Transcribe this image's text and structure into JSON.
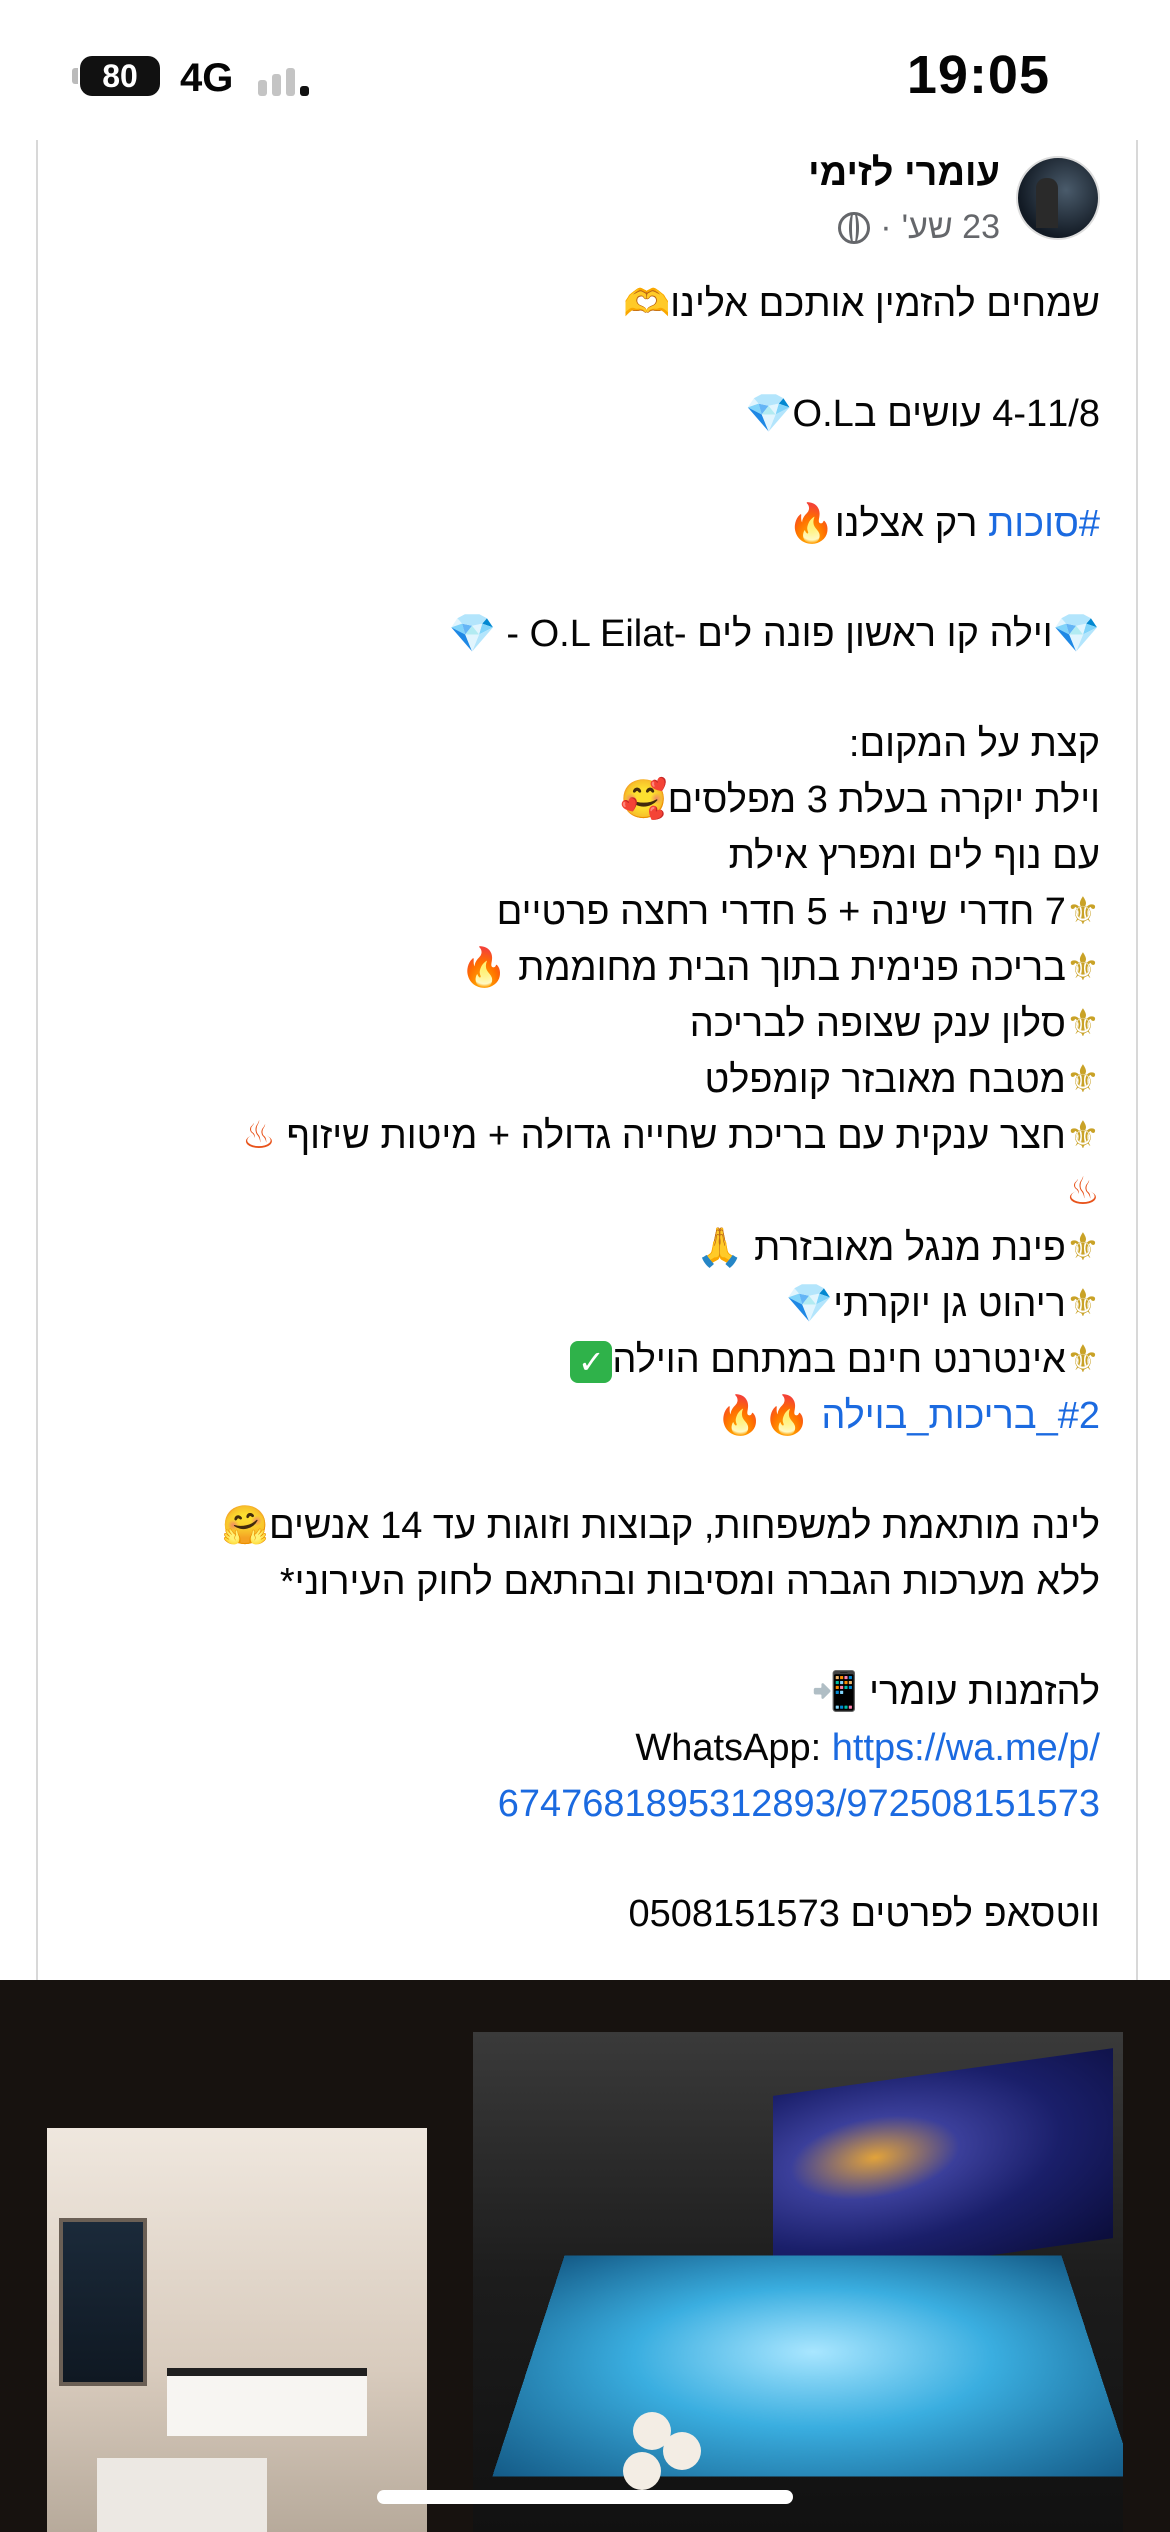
{
  "status_bar": {
    "time": "19:05",
    "battery": "80",
    "network": "4G"
  },
  "post": {
    "author": "עומרי לזימי",
    "time": "23 שע'",
    "dot": "·",
    "lines": [
      {
        "text": "שמחים להזמין אותכם אלינו",
        "emoji": "🫶"
      },
      {
        "text": "4-11/8 עושים בO.L",
        "emoji": "💎"
      },
      {
        "hashtag": "#סוכות",
        "text": " רק אצלנו",
        "emoji": "🔥"
      },
      {
        "emoji_pre": "💎",
        "text": "וילה קו ראשון פונה לים -O.L Eilat - ",
        "emoji": "💎"
      },
      {
        "text": "קצת על המקום:"
      },
      {
        "text": "וילת יוקרה בעלת 3 מפלסים",
        "emoji": "🥰"
      },
      {
        "text": "עם נוף לים ומפרץ אילת"
      },
      {
        "bullet": "⚜",
        "text": "7 חדרי שינה + 5 חדרי רחצה פרטיים"
      },
      {
        "bullet": "⚜",
        "text": "בריכה פנימית בתוך הבית מחוממת ",
        "emoji": "🔥"
      },
      {
        "bullet": "⚜",
        "text": "סלון ענק שצופה לבריכה"
      },
      {
        "bullet": "⚜",
        "text": "מטבח מאובזר קומפלט"
      },
      {
        "bullet": "⚜",
        "text": "חצר ענקית עם בריכת שחייה גדולה + מיטות שיזוף ",
        "emoji": "♨"
      },
      {
        "text": "",
        "emoji": "♨"
      },
      {
        "bullet": "⚜",
        "text": "פינת מנגל מאובזרת ",
        "emoji": "🙏"
      },
      {
        "bullet": "⚜",
        "text": "ריהוט גן יוקרתי",
        "emoji": "💎"
      },
      {
        "bullet": "⚜",
        "text": "אינטרנט חינם במתחם הוילה",
        "emoji": "✓"
      },
      {
        "hashtag": "#2_בריכות_בוילה",
        "text": " ",
        "emoji": "🔥🔥"
      },
      {
        "text": "לינה מותאמת למשפחות, קבוצות וזוגות עד 14 אנשים",
        "emoji": "🤗"
      },
      {
        "text": "ללא מערכות הגברה ומסיבות ובהתאם לחוק העירוני*"
      },
      {
        "text": "להזמנות עומרי ",
        "emoji": "📲"
      },
      {
        "prefix": "WhatsApp: ",
        "url1": "https://wa.me/p/",
        "url2": "6747681895312893/972508151573"
      },
      {
        "text": "ווטסאפ לפרטים 0508151573"
      }
    ]
  },
  "colors": {
    "link": "#1b6ae0",
    "meta": "#65676b",
    "photo_bg": "#17120f"
  }
}
